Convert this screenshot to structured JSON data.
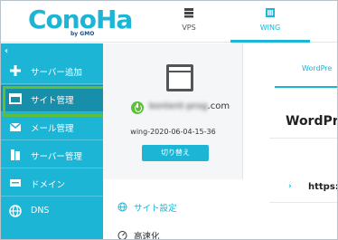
{
  "header": {
    "logo_text": "ConoHa",
    "logo_sub": "by GMO",
    "tabs": [
      {
        "label": "VPS",
        "icon": "server-icon"
      },
      {
        "label": "WING",
        "icon": "wing-icon"
      }
    ]
  },
  "sidebar": {
    "collapse_label": "‹",
    "items": [
      {
        "label": "サーバー追加",
        "icon": "plus-icon"
      },
      {
        "label": "サイト管理",
        "icon": "site-icon"
      },
      {
        "label": "メール管理",
        "icon": "mail-icon"
      },
      {
        "label": "サーバー管理",
        "icon": "server-manage-icon"
      },
      {
        "label": "ドメイン",
        "icon": "domain-icon"
      },
      {
        "label": "DNS",
        "icon": "globe-icon"
      }
    ],
    "accent_color": "#1db5d6",
    "highlight_color": "#5fbf3a"
  },
  "site": {
    "domain_blurred": "kontent-prog",
    "domain_suffix": ".com",
    "stamp": "wing-2020-06-04-15-36",
    "switch_label": "切り替え",
    "menu": [
      {
        "label": "サイト設定",
        "icon": "globe-outline-icon"
      },
      {
        "label": "高速化",
        "icon": "speed-icon"
      }
    ]
  },
  "content": {
    "tab_label": "WordPre",
    "heading": "WordPre",
    "url_label": "https:/"
  }
}
